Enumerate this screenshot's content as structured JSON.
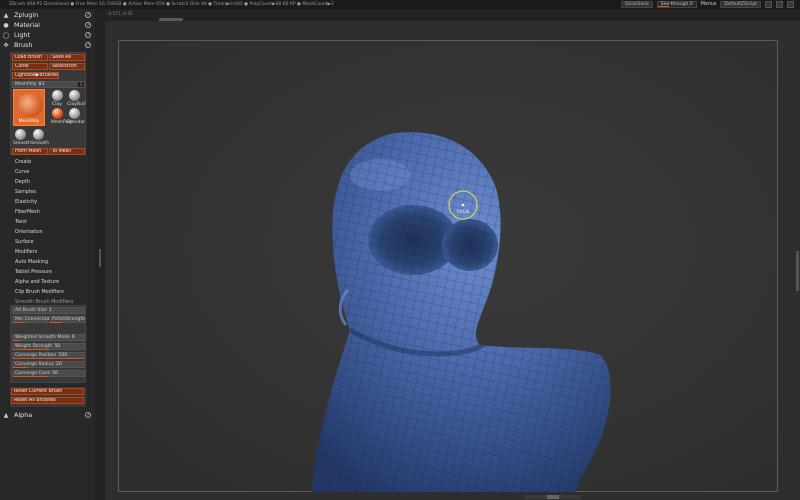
{
  "topbar": {
    "status": "ZBrush 4R8 P2     DemoHead     ● Free Mem 16.746GB  ● Active Mem 659  ● Scratch Disk 48  ● Timer▶0.005  ● PolyCount▶68.66 KP  ● MeshCount▶2",
    "quicksave": "QuickSave",
    "seethrough_label": "See-through",
    "seethrough_value": "0",
    "menus": "Menus",
    "script": "DefaultZScript"
  },
  "subbar": {
    "coords": "-0.571,-0.35"
  },
  "tray": {
    "zplugin": "Zplugin",
    "material": "Material",
    "light": "Light",
    "brush": "Brush",
    "alpha": "Alpha"
  },
  "brush_panel": {
    "load_brush": "Load Brush",
    "save_as": "Save As",
    "clone": "Clone",
    "select_icon": "SelectIcon",
    "lightbox_brushes": "Lightbox▶Brushes",
    "mesh_poly_label": "MeshPoly",
    "mesh_poly_value": "83",
    "mesh_poly_box": "R",
    "main_brush_label": "MeshPoly",
    "brushes": [
      "Clay",
      "ClayBuil",
      "MeshPoly",
      "Standar",
      "Smooth",
      "Smooth"
    ],
    "from_mesh": "From Mesh",
    "to_mesh": "To Mesh"
  },
  "submenus": [
    "Create",
    "Curve",
    "Depth",
    "Samples",
    "Elasticity",
    "FiberMesh",
    "Twist",
    "Orientation",
    "Surface",
    "Modifiers",
    "Auto Masking",
    "Tablet Pressure",
    "Alpha and Texture",
    "Clip Brush Modifiers"
  ],
  "smooth_panel": {
    "title": "Smooth Brush Modifiers",
    "alt_brush_size_label": "Alt Brush Size",
    "alt_brush_size_value": "1",
    "alt_brush_size_fraction": 0.02,
    "min_connected": "Min Connected",
    "min_connected_fraction": 0.35,
    "polish_strength": "PolishStrength",
    "polish_strength_fraction": 0.35,
    "weighted_label": "Weighted Smooth Mode",
    "weighted_value": "6",
    "weighted_fraction": 0.1,
    "weight_strength_label": "Weight Strength",
    "weight_strength_value": "50",
    "weight_strength_fraction": 0.5,
    "converge_position_label": "Converge Position",
    "converge_position_value": "100",
    "converge_position_fraction": 1.0,
    "converge_radius_label": "Converge Radius",
    "converge_radius_value": "20",
    "converge_radius_fraction": 0.2,
    "converge_cone_label": "Converge Cone",
    "converge_cone_value": "50",
    "converge_cone_fraction": 0.5
  },
  "reset": {
    "reset_current": "Reset Current Brush",
    "reset_all": "Reset All Brushes"
  },
  "cursor_label": "FOCAL",
  "colors": {
    "accent": "#e0531a",
    "model_blue": "#3f5f9e",
    "cursor_ring": "#d8d060"
  }
}
